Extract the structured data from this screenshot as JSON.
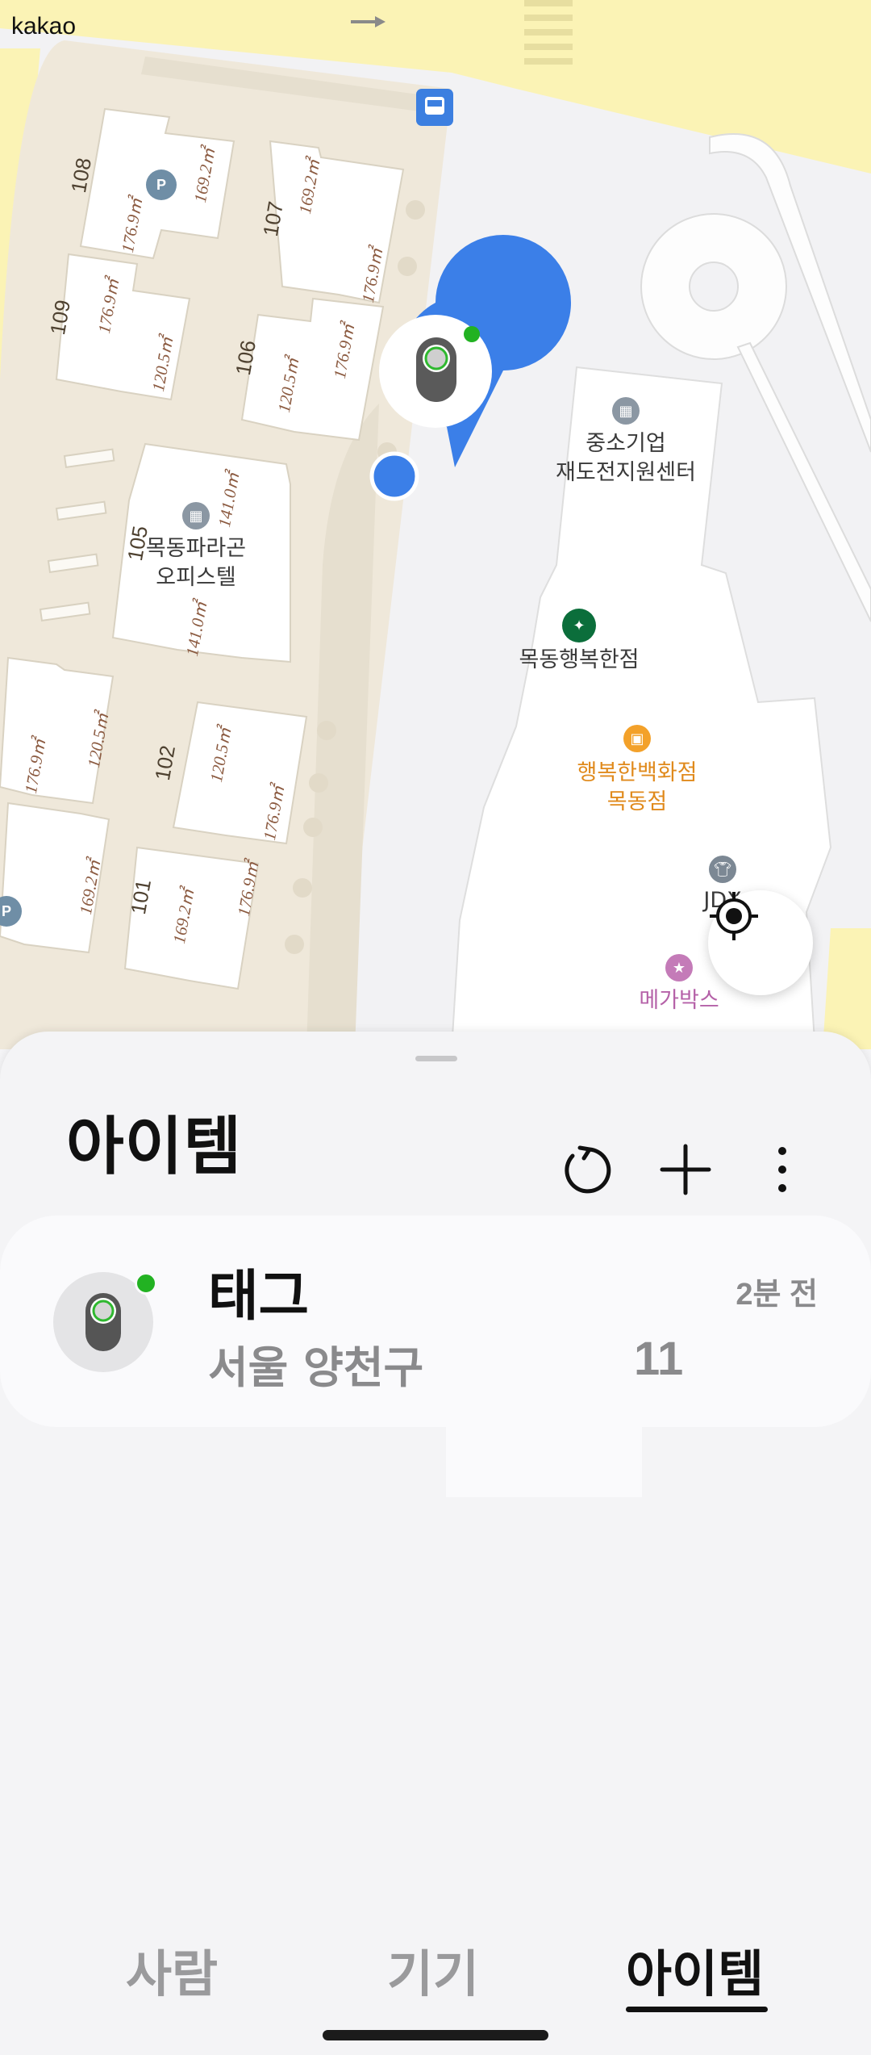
{
  "map": {
    "provider_logo": "kakao",
    "pois": [
      {
        "name": "중소기업\n재도전지원센터",
        "icon": "building-icon"
      },
      {
        "name": "목동행복한점",
        "icon": "starbucks-icon"
      },
      {
        "name": "행복한백화점\n목동점",
        "icon": "shopping-bag-icon"
      },
      {
        "name": "JDX",
        "icon": "shirt-icon"
      },
      {
        "name": "메가박스",
        "icon": "movie-icon"
      },
      {
        "name": "목동파라곤\n오피스텔",
        "icon": "building-icon"
      }
    ],
    "buildings": [
      "108",
      "107",
      "109",
      "106",
      "105",
      "102",
      "101"
    ],
    "areas": [
      "169.2㎡",
      "176.9㎡",
      "169.2㎡",
      "176.9㎡",
      "176.9㎡",
      "120.5㎡",
      "120.5㎡",
      "176.9㎡",
      "141.0㎡",
      "141.0㎡",
      "176.9㎡",
      "120.5㎡",
      "120.5㎡",
      "176.9㎡",
      "169.2㎡",
      "169.2㎡",
      "176.9㎡"
    ],
    "parking_label": "P",
    "colors": {
      "road": "#fbf3b5",
      "block": "#efe9dd",
      "pin": "#3b7fe8",
      "online": "#22b222"
    }
  },
  "sheet": {
    "title": "아이템",
    "actions": [
      "refresh-icon",
      "add-icon",
      "more-icon"
    ]
  },
  "item": {
    "name": "태그",
    "time": "2분 전",
    "address": "서울 양천구 \u0000",
    "address_visible": "서울 양천구 ",
    "number": "11"
  },
  "tabs": {
    "people": "사람",
    "devices": "기기",
    "items": "아이템"
  }
}
